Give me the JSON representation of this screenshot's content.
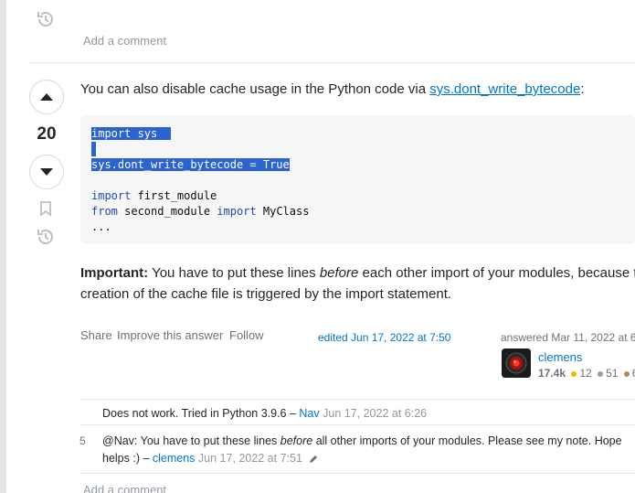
{
  "top": {
    "add_comment": "Add a comment"
  },
  "answer": {
    "score": "20",
    "intro_text": "You can also disable cache usage in the Python code via ",
    "intro_link": "sys.dont_write_bytecode",
    "intro_colon": ":",
    "code": {
      "line1": "import sys",
      "line2": "sys.dont_write_bytecode = True",
      "line3_kw": "import",
      "line3_rest": " first_module",
      "line4_kw1": "from",
      "line4_mid": " second_module ",
      "line4_kw2": "import",
      "line4_rest": " MyClass",
      "line5": "..."
    },
    "important_label": "Important:",
    "important_text1": " You have to put these lines ",
    "important_em": "before",
    "important_text2": " each other import of your modules, because t",
    "important_line2": "creation of the cache file is triggered by the import statement.",
    "actions": {
      "share": "Share",
      "improve": "Improve this answer",
      "follow": "Follow"
    },
    "edited": "edited Jun 17, 2022 at 7:50",
    "answered": "answered Mar 11, 2022 at 6",
    "user": {
      "name": "clemens",
      "reputation": "17.4k",
      "gold": "12",
      "silver": "51",
      "bronze": "6"
    }
  },
  "comments": [
    {
      "score": "",
      "text": "Does not work. Tried in Python 3.9.6 – ",
      "user": "Nav",
      "date": "Jun 17, 2022 at 6:26"
    },
    {
      "score": "5",
      "text_a": "@Nav: You have to put these lines ",
      "text_em": "before",
      "text_b": " all other imports of your modules. Please see my note. Hope",
      "text_c": "helps :) – ",
      "user": "clemens",
      "date": "Jun 17, 2022 at 7:51"
    }
  ],
  "bottom": {
    "add_comment": "Add a comment"
  },
  "colors": {
    "link": "#0074cc",
    "selection": "#2b62d4",
    "gold": "#f1b600",
    "silver": "#9a9c9f",
    "bronze": "#ab8a5f"
  }
}
